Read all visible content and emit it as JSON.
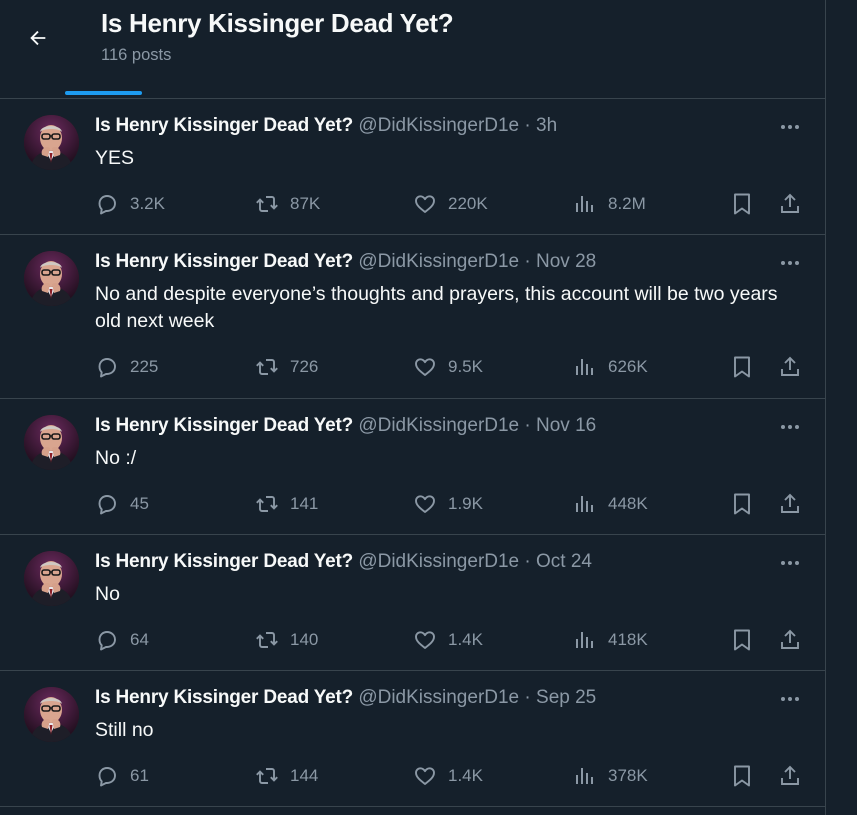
{
  "header": {
    "title": "Is Henry Kissinger Dead Yet?",
    "post_count": "116 posts"
  },
  "colors": {
    "background": "#15202b",
    "accent": "#1d9bf0",
    "muted": "#8b98a5",
    "border": "#38444d"
  },
  "posts": [
    {
      "name": "Is Henry Kissinger Dead Yet?",
      "handle": "@DidKissingerD1e",
      "dot": "·",
      "time": "3h",
      "text": "YES",
      "replies": "3.2K",
      "reposts": "87K",
      "likes": "220K",
      "views": "8.2M"
    },
    {
      "name": "Is Henry Kissinger Dead Yet?",
      "handle": "@DidKissingerD1e",
      "dot": "·",
      "time": "Nov 28",
      "text": "No and despite everyone’s thoughts and prayers, this account will be two years old next week",
      "replies": "225",
      "reposts": "726",
      "likes": "9.5K",
      "views": "626K"
    },
    {
      "name": "Is Henry Kissinger Dead Yet?",
      "handle": "@DidKissingerD1e",
      "dot": "·",
      "time": "Nov 16",
      "text": "No :/",
      "replies": "45",
      "reposts": "141",
      "likes": "1.9K",
      "views": "448K"
    },
    {
      "name": "Is Henry Kissinger Dead Yet?",
      "handle": "@DidKissingerD1e",
      "dot": "·",
      "time": "Oct 24",
      "text": "No",
      "replies": "64",
      "reposts": "140",
      "likes": "1.4K",
      "views": "418K"
    },
    {
      "name": "Is Henry Kissinger Dead Yet?",
      "handle": "@DidKissingerD1e",
      "dot": "·",
      "time": "Sep 25",
      "text": "Still no",
      "replies": "61",
      "reposts": "144",
      "likes": "1.4K",
      "views": "378K"
    }
  ]
}
